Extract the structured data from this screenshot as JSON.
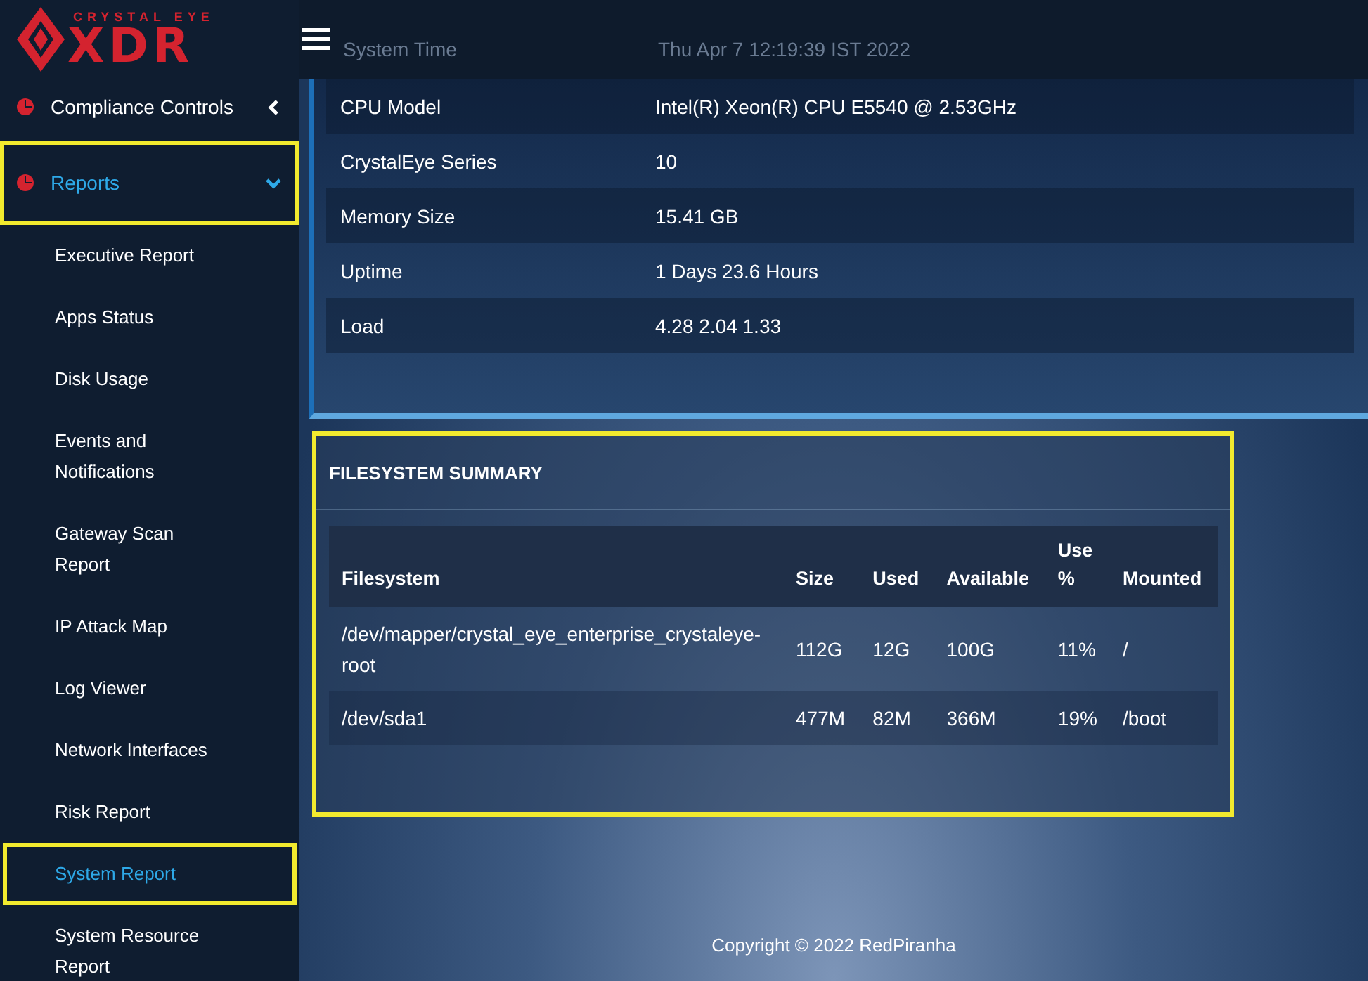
{
  "logo": {
    "top": "CRYSTAL EYE",
    "bottom": "XDR"
  },
  "sidebar": {
    "items": [
      {
        "label": "Compliance Controls",
        "selected": false,
        "expanded": false,
        "highlighted": false
      },
      {
        "label": "Reports",
        "selected": true,
        "expanded": true,
        "highlighted": true,
        "children": [
          {
            "label": "Executive Report",
            "selected": false,
            "highlighted": false
          },
          {
            "label": "Apps Status",
            "selected": false,
            "highlighted": false
          },
          {
            "label": "Disk Usage",
            "selected": false,
            "highlighted": false
          },
          {
            "label": "Events and Notifications",
            "selected": false,
            "highlighted": false
          },
          {
            "label": "Gateway Scan Report",
            "selected": false,
            "highlighted": false
          },
          {
            "label": "IP Attack Map",
            "selected": false,
            "highlighted": false
          },
          {
            "label": "Log Viewer",
            "selected": false,
            "highlighted": false
          },
          {
            "label": "Network Interfaces",
            "selected": false,
            "highlighted": false
          },
          {
            "label": "Risk Report",
            "selected": false,
            "highlighted": false
          },
          {
            "label": "System Report",
            "selected": true,
            "highlighted": true
          },
          {
            "label": "System Resource Report",
            "selected": false,
            "highlighted": false
          }
        ]
      }
    ]
  },
  "header": {
    "label": "System Time",
    "value": "Thu Apr 7 12:19:39 IST 2022"
  },
  "system_info": [
    {
      "label": "CPU Model",
      "value": "Intel(R) Xeon(R) CPU E5540 @ 2.53GHz"
    },
    {
      "label": "CrystalEye Series",
      "value": "10"
    },
    {
      "label": "Memory Size",
      "value": "15.41 GB"
    },
    {
      "label": "Uptime",
      "value": "1 Days 23.6 Hours"
    },
    {
      "label": "Load",
      "value": "4.28 2.04 1.33"
    }
  ],
  "filesystem_summary": {
    "title": "FILESYSTEM SUMMARY",
    "highlighted": true,
    "columns": [
      "Filesystem",
      "Size",
      "Used",
      "Available",
      "Use %",
      "Mounted"
    ],
    "rows": [
      [
        "/dev/mapper/crystal_eye_enterprise_crystaleye-root",
        "112G",
        "12G",
        "100G",
        "11%",
        "/"
      ],
      [
        "/dev/sda1",
        "477M",
        "82M",
        "366M",
        "19%",
        "/boot"
      ]
    ]
  },
  "footer": "Copyright © 2022 RedPiranha"
}
